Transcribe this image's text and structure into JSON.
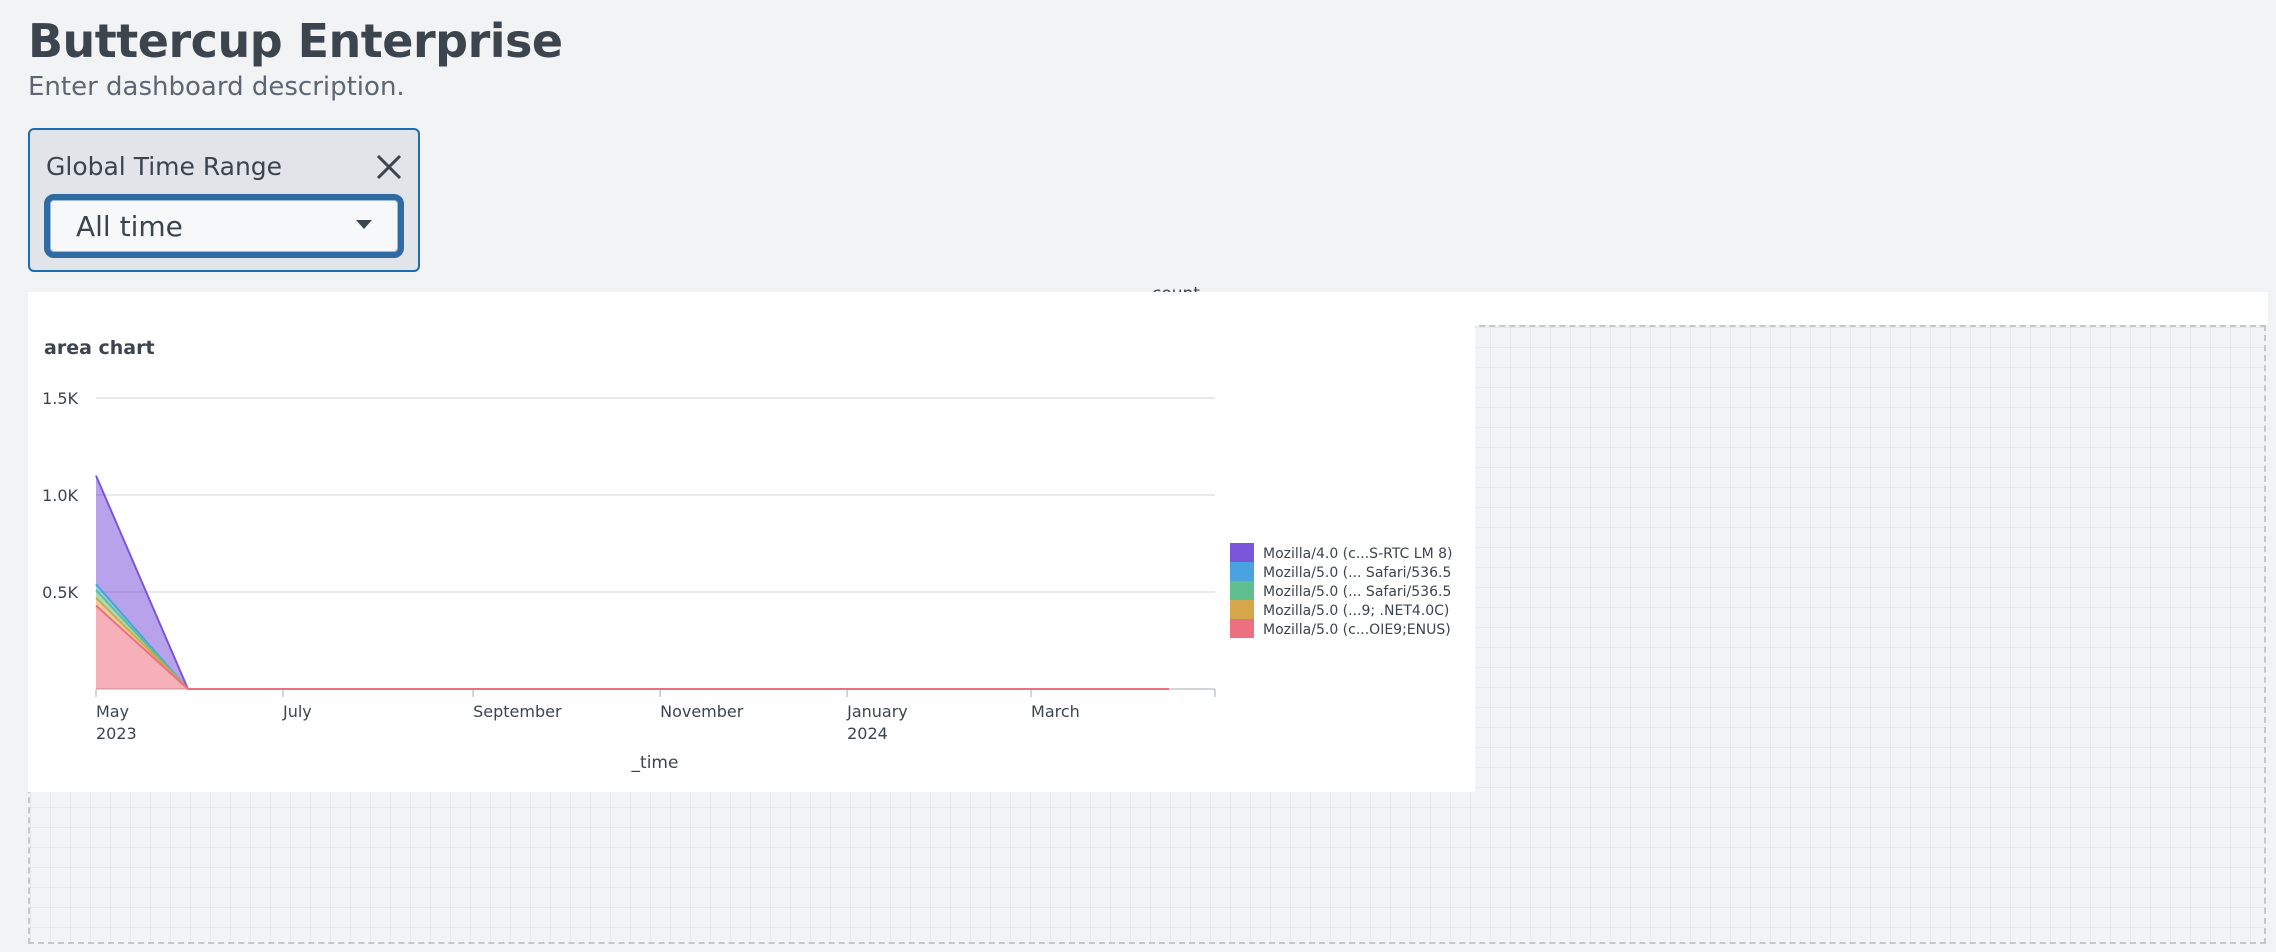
{
  "dashboard": {
    "title": "Buttercup Enterprise",
    "description": "Enter dashboard description."
  },
  "time_input": {
    "label": "Global Time Range",
    "selected": "All time"
  },
  "canvas": {
    "header_text": "count"
  },
  "chart_data": {
    "type": "area",
    "title": "area chart",
    "xlabel": "_time",
    "ylabel": "",
    "stacked": true,
    "ylim": [
      0,
      1500
    ],
    "yticks": [
      {
        "value": 500,
        "label": "0.5K"
      },
      {
        "value": 1000,
        "label": "1.0K"
      },
      {
        "value": 1500,
        "label": "1.5K"
      }
    ],
    "xlim": [
      "2023-05-01",
      "2024-04-30"
    ],
    "xticks": [
      {
        "date": "2023-05-01",
        "label": "May",
        "sublabel": "2023"
      },
      {
        "date": "2023-07-01",
        "label": "July",
        "sublabel": ""
      },
      {
        "date": "2023-09-01",
        "label": "September",
        "sublabel": ""
      },
      {
        "date": "2023-11-01",
        "label": "November",
        "sublabel": ""
      },
      {
        "date": "2024-01-01",
        "label": "January",
        "sublabel": "2024"
      },
      {
        "date": "2024-03-01",
        "label": "March",
        "sublabel": ""
      }
    ],
    "x": [
      "2023-05-01",
      "2023-05-31",
      "2024-04-15"
    ],
    "series": [
      {
        "name": "Mozilla/5.0 (c...OIE9;ENUS)",
        "color": "#ec7080",
        "values": [
          430,
          0,
          0
        ]
      },
      {
        "name": "Mozilla/5.0 (...9; .NET4.0C)",
        "color": "#d6a74a",
        "values": [
          40,
          0,
          0
        ]
      },
      {
        "name": "Mozilla/5.0 (... Safari/536.5",
        "color": "#5fbf8f",
        "values": [
          40,
          0,
          0
        ]
      },
      {
        "name": "Mozilla/5.0 (... Safari/536.5",
        "color": "#4aa3df",
        "values": [
          30,
          0,
          0
        ]
      },
      {
        "name": "Mozilla/4.0 (c...S-RTC LM 8)",
        "color": "#7b56db",
        "values": [
          560,
          0,
          0
        ]
      }
    ],
    "legend": {
      "position": "right",
      "order": [
        4,
        3,
        2,
        1,
        0
      ]
    },
    "grid": true
  }
}
